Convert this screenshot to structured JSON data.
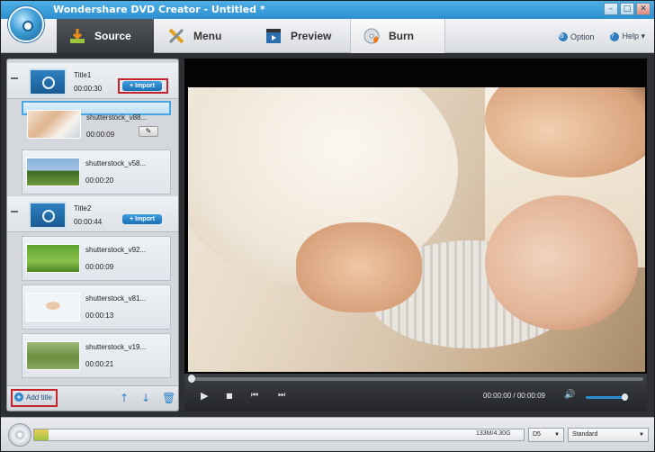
{
  "app": {
    "title": "Wondershare DVD Creator - Untitled *",
    "window_buttons": [
      "–",
      "□",
      "✕"
    ]
  },
  "tabs": [
    {
      "label": "Source",
      "active": true
    },
    {
      "label": "Menu",
      "active": false
    },
    {
      "label": "Preview",
      "active": false
    },
    {
      "label": "Burn",
      "active": false
    }
  ],
  "topright": {
    "option_label": "Option",
    "help_label": "Help ▾"
  },
  "titles": [
    {
      "name": "Title1",
      "duration": "00:00:30",
      "import_label": "+ Import",
      "clips": [
        {
          "name": "shutterstock_v88...",
          "duration": "00:00:09",
          "selected": true
        },
        {
          "name": "shutterstock_v58...",
          "duration": "00:00:20",
          "selected": false
        }
      ]
    },
    {
      "name": "Title2",
      "duration": "00:00:44",
      "import_label": "+ Import",
      "clips": [
        {
          "name": "shutterstock_v92...",
          "duration": "00:00:09"
        },
        {
          "name": "shutterstock_v81...",
          "duration": "00:00:13"
        },
        {
          "name": "shutterstock_v19...",
          "duration": "00:00:21"
        }
      ]
    }
  ],
  "panel_footer": {
    "add_title_label": "Add title"
  },
  "player": {
    "current_time": "00:00:00",
    "separator": "/",
    "total_time": "00:00:09",
    "seek_fraction": 0.0,
    "volume_fraction": 0.85
  },
  "bottom": {
    "capacity_text": "133M/4.30G",
    "capacity_fraction": 0.03,
    "disc_type": "D5",
    "quality": "Standard"
  },
  "colors": {
    "accent": "#2f86c9",
    "highlight_box": "#c4222d"
  }
}
